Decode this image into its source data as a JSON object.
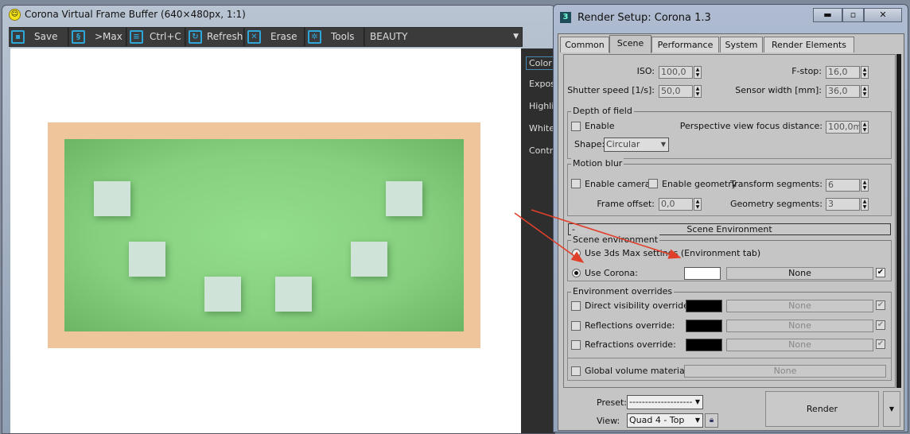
{
  "vfb": {
    "title": "Corona Virtual Frame Buffer (640×480px, 1:1)",
    "toolbar": [
      {
        "label": "Save",
        "icon": "floppy-icon"
      },
      {
        "label": ">Max",
        "icon": "max-icon"
      },
      {
        "label": "Ctrl+C",
        "icon": "clipboard-icon"
      },
      {
        "label": "Refresh",
        "icon": "refresh-icon"
      },
      {
        "label": "Erase",
        "icon": "erase-icon"
      },
      {
        "label": "Tools",
        "icon": "gear-icon"
      }
    ],
    "channel": "BEAUTY",
    "side_items": [
      "Color",
      "Expos",
      "Highlig",
      "White",
      "Contr"
    ]
  },
  "rs": {
    "title": "Render Setup: Corona 1.3",
    "tabs": [
      "Common",
      "Scene",
      "Performance",
      "System",
      "Render Elements"
    ],
    "active_tab": "Scene",
    "camera": {
      "iso_label": "ISO:",
      "iso": "100,0",
      "fstop_label": "F-stop:",
      "fstop": "16,0",
      "shutter_label": "Shutter speed [1/s]:",
      "shutter": "50,0",
      "sensor_label": "Sensor width [mm]:",
      "sensor": "36,0"
    },
    "dof": {
      "title": "Depth of field",
      "enable": "Enable",
      "focus_label": "Perspective view focus distance:",
      "focus": "100,0mm",
      "shape_label": "Shape:",
      "shape": "Circular"
    },
    "mb": {
      "title": "Motion blur",
      "enable_camera": "Enable camera",
      "enable_geometry": "Enable geometry",
      "transform_label": "Transform segments:",
      "transform": "6",
      "offset_label": "Frame offset:",
      "offset": "0,0",
      "geometry_label": "Geometry segments:",
      "geometry": "3"
    },
    "env": {
      "rollout": "Scene Environment",
      "collapse": "-",
      "group": "Scene environment",
      "use_max": "Use 3ds Max settings (Environment tab)",
      "use_corona": "Use Corona:",
      "map": "None",
      "color": "#ffffff"
    },
    "overrides": {
      "title": "Environment overrides",
      "items": [
        "Direct visibility override:",
        "Reflections override:",
        "Refractions override:"
      ],
      "map": "None",
      "color": "#000000"
    },
    "volume": {
      "label": "Global volume material:",
      "map": "None"
    },
    "footer": {
      "preset_label": "Preset:",
      "preset": "--------------------",
      "view_label": "View:",
      "view": "Quad 4 - Top",
      "render": "Render"
    }
  },
  "annotation_color": "#e0402a"
}
